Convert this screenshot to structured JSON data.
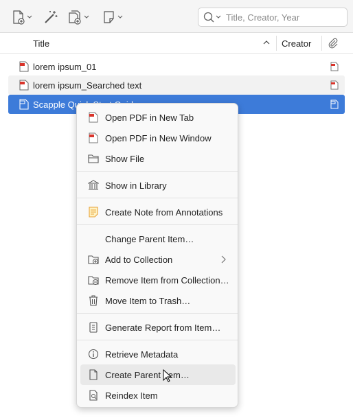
{
  "toolbar": {
    "new_item_icon": "new-item-icon",
    "magic_wand_icon": "add-by-identifier-icon",
    "attachment_icon": "add-attachment-icon",
    "note_icon": "new-note-icon",
    "search_placeholder": "Title, Creator, Year",
    "search_value": ""
  },
  "columns": {
    "title": "Title",
    "creator": "Creator",
    "sort_direction": "ascending",
    "attachment_icon": "paperclip-icon"
  },
  "items": [
    {
      "title": "lorem ipsum_01",
      "type": "pdf",
      "state": "normal"
    },
    {
      "title": "lorem ipsum_Searched text",
      "type": "pdf",
      "state": "alternate"
    },
    {
      "title": "Scapple Quick Start Guide",
      "type": "pdf",
      "state": "selected"
    }
  ],
  "context_menu": {
    "items": [
      {
        "label": "Open PDF in New Tab",
        "icon": "pdf-icon"
      },
      {
        "label": "Open PDF in New Window",
        "icon": "pdf-icon"
      },
      {
        "label": "Show File",
        "icon": "folder-icon"
      },
      {
        "label": "Show in Library",
        "icon": "library-icon"
      },
      {
        "label": "Create Note from Annotations",
        "icon": "note-icon"
      },
      {
        "label": "Change Parent Item…",
        "icon": ""
      },
      {
        "label": "Add to Collection",
        "icon": "add-collection-icon",
        "submenu": true
      },
      {
        "label": "Remove Item from Collection…",
        "icon": "remove-collection-icon"
      },
      {
        "label": "Move Item to Trash…",
        "icon": "trash-icon"
      },
      {
        "label": "Generate Report from Item…",
        "icon": "report-icon"
      },
      {
        "label": "Retrieve Metadata",
        "icon": "info-icon"
      },
      {
        "label": "Create Parent Item…",
        "icon": "document-icon",
        "hovered": true
      },
      {
        "label": "Reindex Item",
        "icon": "reindex-icon"
      }
    ]
  },
  "colors": {
    "selection": "#3d7bd9",
    "pdf_red": "#d9342b",
    "note_yellow": "#e8a33a"
  }
}
